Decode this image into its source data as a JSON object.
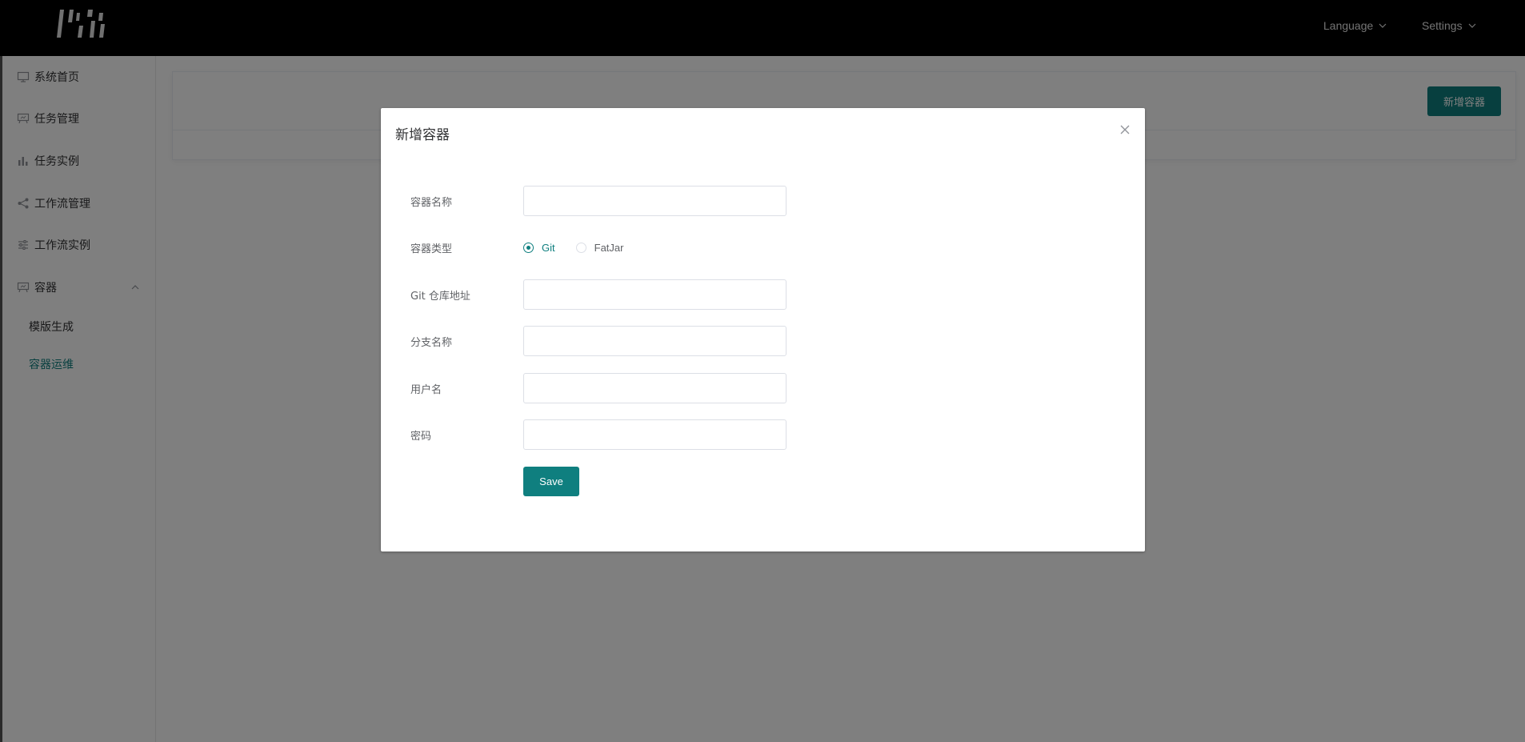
{
  "header": {
    "language_label": "Language",
    "settings_label": "Settings"
  },
  "sidebar": {
    "items": [
      {
        "label": "系统首页",
        "icon": "monitor-icon"
      },
      {
        "label": "任务管理",
        "icon": "board-icon"
      },
      {
        "label": "任务实例",
        "icon": "bar-chart-icon"
      },
      {
        "label": "工作流管理",
        "icon": "share-icon"
      },
      {
        "label": "工作流实例",
        "icon": "sliders-icon"
      },
      {
        "label": "容器",
        "icon": "board-icon",
        "expanded": true
      }
    ],
    "subitems": [
      {
        "label": "模版生成",
        "active": false
      },
      {
        "label": "容器运维",
        "active": true
      }
    ]
  },
  "main": {
    "new_container_button": "新增容器"
  },
  "dialog": {
    "title": "新增容器",
    "fields": {
      "container_name": {
        "label": "容器名称",
        "value": ""
      },
      "container_type": {
        "label": "容器类型",
        "options": [
          "Git",
          "FatJar"
        ],
        "selected": "Git"
      },
      "git_repo_url": {
        "label": "Git 仓库地址",
        "value": ""
      },
      "branch_name": {
        "label": "分支名称",
        "value": ""
      },
      "username": {
        "label": "用户名",
        "value": ""
      },
      "password": {
        "label": "密码",
        "value": ""
      }
    },
    "save_button": "Save"
  },
  "colors": {
    "accent": "#0f7f7f",
    "header_bg": "#000000",
    "overlay": "rgba(0,0,0,0.5)"
  }
}
